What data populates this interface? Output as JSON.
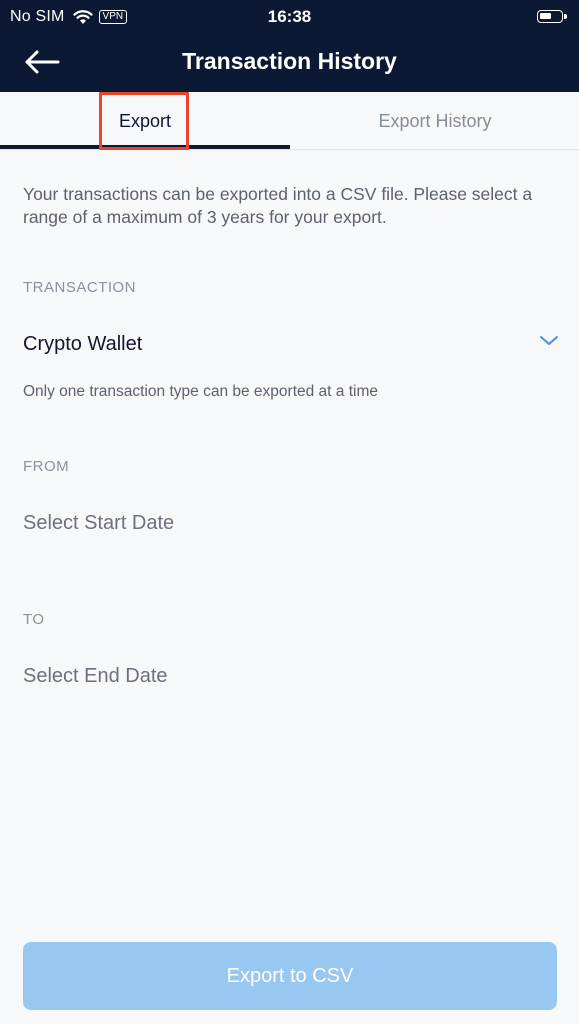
{
  "status_bar": {
    "carrier": "No SIM",
    "vpn_badge": "VPN",
    "time": "16:38",
    "battery_icon": "battery-icon",
    "wifi_icon": "wifi-icon"
  },
  "header": {
    "title": "Transaction History",
    "back_icon": "back-arrow-icon"
  },
  "tabs": [
    {
      "label": "Export",
      "active": true
    },
    {
      "label": "Export History",
      "active": false
    }
  ],
  "intro_text": "Your transactions can be exported into a CSV file. Please select a range of a maximum of 3 years for your export.",
  "transaction": {
    "label": "TRANSACTION",
    "value": "Crypto Wallet",
    "hint": "Only one transaction type can be exported at a time"
  },
  "from": {
    "label": "FROM",
    "placeholder": "Select Start Date"
  },
  "to": {
    "label": "TO",
    "placeholder": "Select End Date"
  },
  "export_button": {
    "label": "Export to CSV"
  },
  "colors": {
    "header_bg": "#0b1935",
    "page_bg": "#f7f8fa",
    "accent_disabled": "#98c8f2",
    "highlight": "#e8462a",
    "chevron": "#4a8fd6"
  }
}
